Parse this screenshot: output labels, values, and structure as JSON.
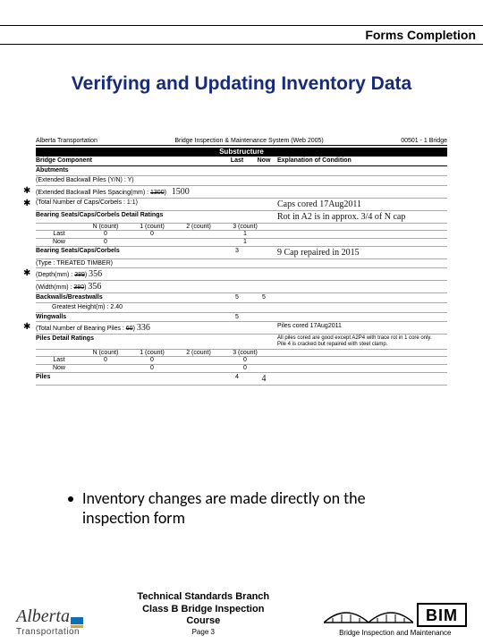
{
  "header": {
    "title": "Forms Completion"
  },
  "slide": {
    "title": "Verifying and Updating Inventory Data"
  },
  "scan": {
    "org": "Alberta Transportation",
    "system": "Bridge Inspection & Maintenance System (Web 2005)",
    "code": "00501 - 1 Bridge",
    "section": "Substructure",
    "columns": {
      "component": "Bridge Component",
      "last": "Last",
      "now": "Now",
      "explanation": "Explanation of Condition"
    },
    "abutments_label": "Abutments",
    "rows": {
      "ext_backwall_piles": {
        "label": "(Extended Backwall Piles (Y/N) : Y)"
      },
      "ext_backwall_spacing": {
        "label": "(Extended Backwall Piles Spacing(mm) :",
        "old": "1300",
        "new_hand": "1500"
      },
      "total_caps": {
        "label": "(Total Number of Caps/Corbels : 1:1)",
        "note_hand": "Caps cored 17Aug2011"
      },
      "bearing_detail": {
        "label": "Bearing Seats/Caps/Corbels Detail Ratings",
        "note_hand": "Rot in A2 is in approx. 3/4 of N cap"
      },
      "count_header": [
        "",
        "N (count)",
        "1 (count)",
        "2 (count)",
        "3 (count)"
      ],
      "last_counts": {
        "label": "Last",
        "vals": [
          "0",
          "0",
          "",
          "1"
        ]
      },
      "now_counts": {
        "label": "Now",
        "vals": [
          "0",
          "",
          "",
          "1"
        ]
      },
      "bearing_seats": {
        "label": "Bearing Seats/Caps/Corbels",
        "last": "3",
        "hand": "9   Cap repaired in 2015"
      },
      "type": {
        "label": "(Type : TREATED TIMBER)"
      },
      "depth": {
        "label": "(Depth(mm) :",
        "old": "389",
        "new_hand": "356"
      },
      "width": {
        "label": "(Width(mm) :",
        "old": "380",
        "new_hand": "356"
      },
      "backwalls": {
        "label": "Backwalls/Breastwalls",
        "last": "5",
        "now": "5"
      },
      "greatest_height": {
        "label": "Greatest Height(m) :",
        "val": "2.40"
      },
      "wingwalls": {
        "label": "Wingwalls",
        "last": "5"
      },
      "total_bearing_piles": {
        "label": "(Total Number of Bearing Piles :",
        "old": "60",
        "new_hand": "336"
      },
      "cored_note": "Piles cored 17Aug2011",
      "piles_detail": {
        "label": "Piles Detail Ratings",
        "note1": "All piles cored are good except A2P4 with trace rot in 1 core only.",
        "note2": "Pile 4 is cracked but repaired with steel clamp."
      },
      "last_counts2": {
        "label": "Last",
        "vals": [
          "0",
          "0",
          "",
          "0"
        ]
      },
      "now_counts2": {
        "label": "Now",
        "vals": [
          "",
          "0",
          "",
          "0"
        ]
      },
      "piles": {
        "label": "Piles",
        "last": "4",
        "hand": "4"
      }
    }
  },
  "bullet": {
    "text": "Inventory changes are made directly on the inspection form"
  },
  "footer": {
    "alberta_word": "Alberta",
    "alberta_sub": "Transportation",
    "line1": "Technical Standards Branch",
    "line2": "Class B Bridge Inspection",
    "line3": "Course",
    "page": "Page 3",
    "bim": "BIM",
    "bim_sub": "Bridge Inspection and Maintenance"
  }
}
